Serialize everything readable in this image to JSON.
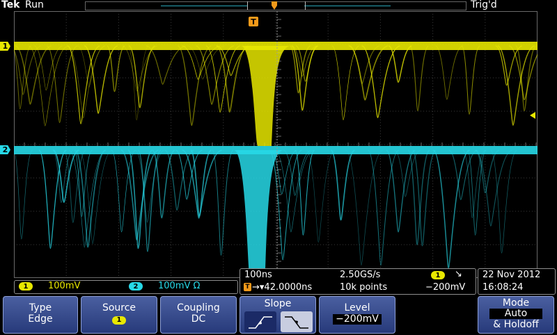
{
  "status": {
    "brand": "Tek",
    "run_state": "Run",
    "trigger_state": "Trig'd"
  },
  "markers": {
    "ch1": "1",
    "ch2": "2",
    "trigger": "T"
  },
  "channels": [
    {
      "id": "1",
      "scale": "100mV",
      "color": "#e8e800"
    },
    {
      "id": "2",
      "scale": "100mV Ω",
      "color": "#27d9e8"
    }
  ],
  "horizontal": {
    "timebase": "100ns",
    "sample_rate": "2.50GS/s",
    "delay": "→▾42.0000ns",
    "record_length": "10k points",
    "trigger_source": "1",
    "trigger_slope_glyph": "↘",
    "trigger_level": "−200mV"
  },
  "datetime": {
    "date": "22 Nov 2012",
    "time": "16:08:24"
  },
  "softkeys": {
    "type": {
      "label": "Type",
      "value": "Edge"
    },
    "source": {
      "label": "Source",
      "value": "1"
    },
    "coupling": {
      "label": "Coupling",
      "value": "DC"
    },
    "slope": {
      "label": "Slope"
    },
    "level": {
      "label": "Level",
      "value": "−200mV"
    },
    "mode": {
      "label": "Mode",
      "value": "Auto",
      "value2": "& Holdoff"
    }
  },
  "colors": {
    "ch1": "#e8e800",
    "ch2": "#27d9e8",
    "trigger": "#f39a1a",
    "softkey": "#3b4f92"
  }
}
